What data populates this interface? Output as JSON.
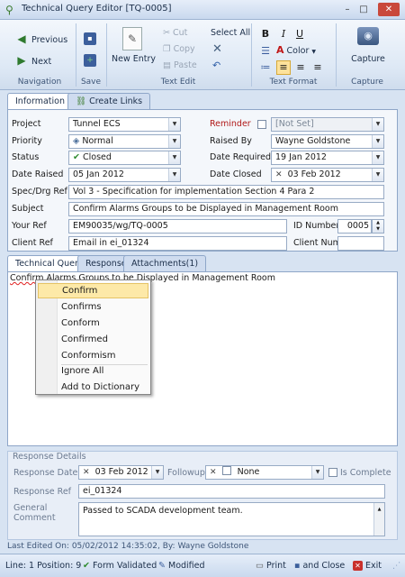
{
  "window": {
    "title": "Technical Query Editor [TQ-0005]",
    "controls": [
      "–",
      "□",
      "✕"
    ]
  },
  "ribbon": {
    "navigation": {
      "previous": "Previous",
      "next": "Next",
      "group": "Navigation"
    },
    "save": {
      "group": "Save"
    },
    "text_edit": {
      "new_entry": "New Entry",
      "cut": "Cut",
      "copy": "Copy",
      "paste": "Paste",
      "select_all": "Select All",
      "group": "Text Edit"
    },
    "text_format": {
      "bold": "B",
      "italic": "I",
      "underline": "U",
      "color": "Color",
      "group": "Text Format"
    },
    "capture": {
      "capture": "Capture",
      "group": "Capture"
    }
  },
  "tabs_top": {
    "information": "Information",
    "create_links": "Create Links"
  },
  "form": {
    "project_label": "Project",
    "project_value": "Tunnel ECS",
    "reminder_label": "Reminder",
    "reminder_value": "[Not Set]",
    "priority_label": "Priority",
    "priority_value": "Normal",
    "raised_by_label": "Raised By",
    "raised_by_value": "Wayne Goldstone",
    "status_label": "Status",
    "status_value": "Closed",
    "date_required_label": "Date Required",
    "date_required_value": "19 Jan 2012",
    "date_raised_label": "Date Raised",
    "date_raised_value": "05 Jan 2012",
    "date_closed_label": "Date Closed",
    "date_closed_value": "03 Feb 2012",
    "spec_label": "Spec/Drg Ref",
    "spec_value": "Vol 3 - Specification for implementation Section 4 Para 2",
    "subject_label": "Subject",
    "subject_value": "Confirm Alarms Groups to be Displayed in Management Room",
    "your_ref_label": "Your Ref",
    "your_ref_value": "EM90035/wg/TQ-0005",
    "id_number_label": "ID Number",
    "id_number_value": "0005",
    "client_ref_label": "Client Ref",
    "client_ref_value": "Email in ei_01324",
    "client_num_label": "Client Num",
    "client_num_value": ""
  },
  "tabs_low": {
    "technical_query": "Technical Query",
    "response": "Response",
    "attachments": "Attachments(1)"
  },
  "query": {
    "text_misspelled": "Confirm",
    "text_rest": " Alarms Groups to be Displayed in Management Room"
  },
  "context_menu": {
    "items": [
      "Confirm",
      "Confirms",
      "Conform",
      "Confirmed",
      "Conformism",
      "Ignore All",
      "Add to Dictionary"
    ]
  },
  "response": {
    "title": "Response Details",
    "response_date_label": "Response Date",
    "response_date_value": "03 Feb 2012",
    "followup_label": "Followup",
    "followup_value": "None",
    "is_complete_label": "Is Complete",
    "response_ref_label": "Response Ref",
    "response_ref_value": "ei_01324",
    "general_comment_label": "General Comment",
    "general_comment_value": "Passed to SCADA development team."
  },
  "last_edited": "Last Edited On: 05/02/2012 14:35:02, By: Wayne Goldstone",
  "status_bar": {
    "position": "Line: 1  Position: 9",
    "validated": "Form Validated",
    "modified": "Modified",
    "print": "Print",
    "and_close": "and Close",
    "exit": "Exit"
  }
}
